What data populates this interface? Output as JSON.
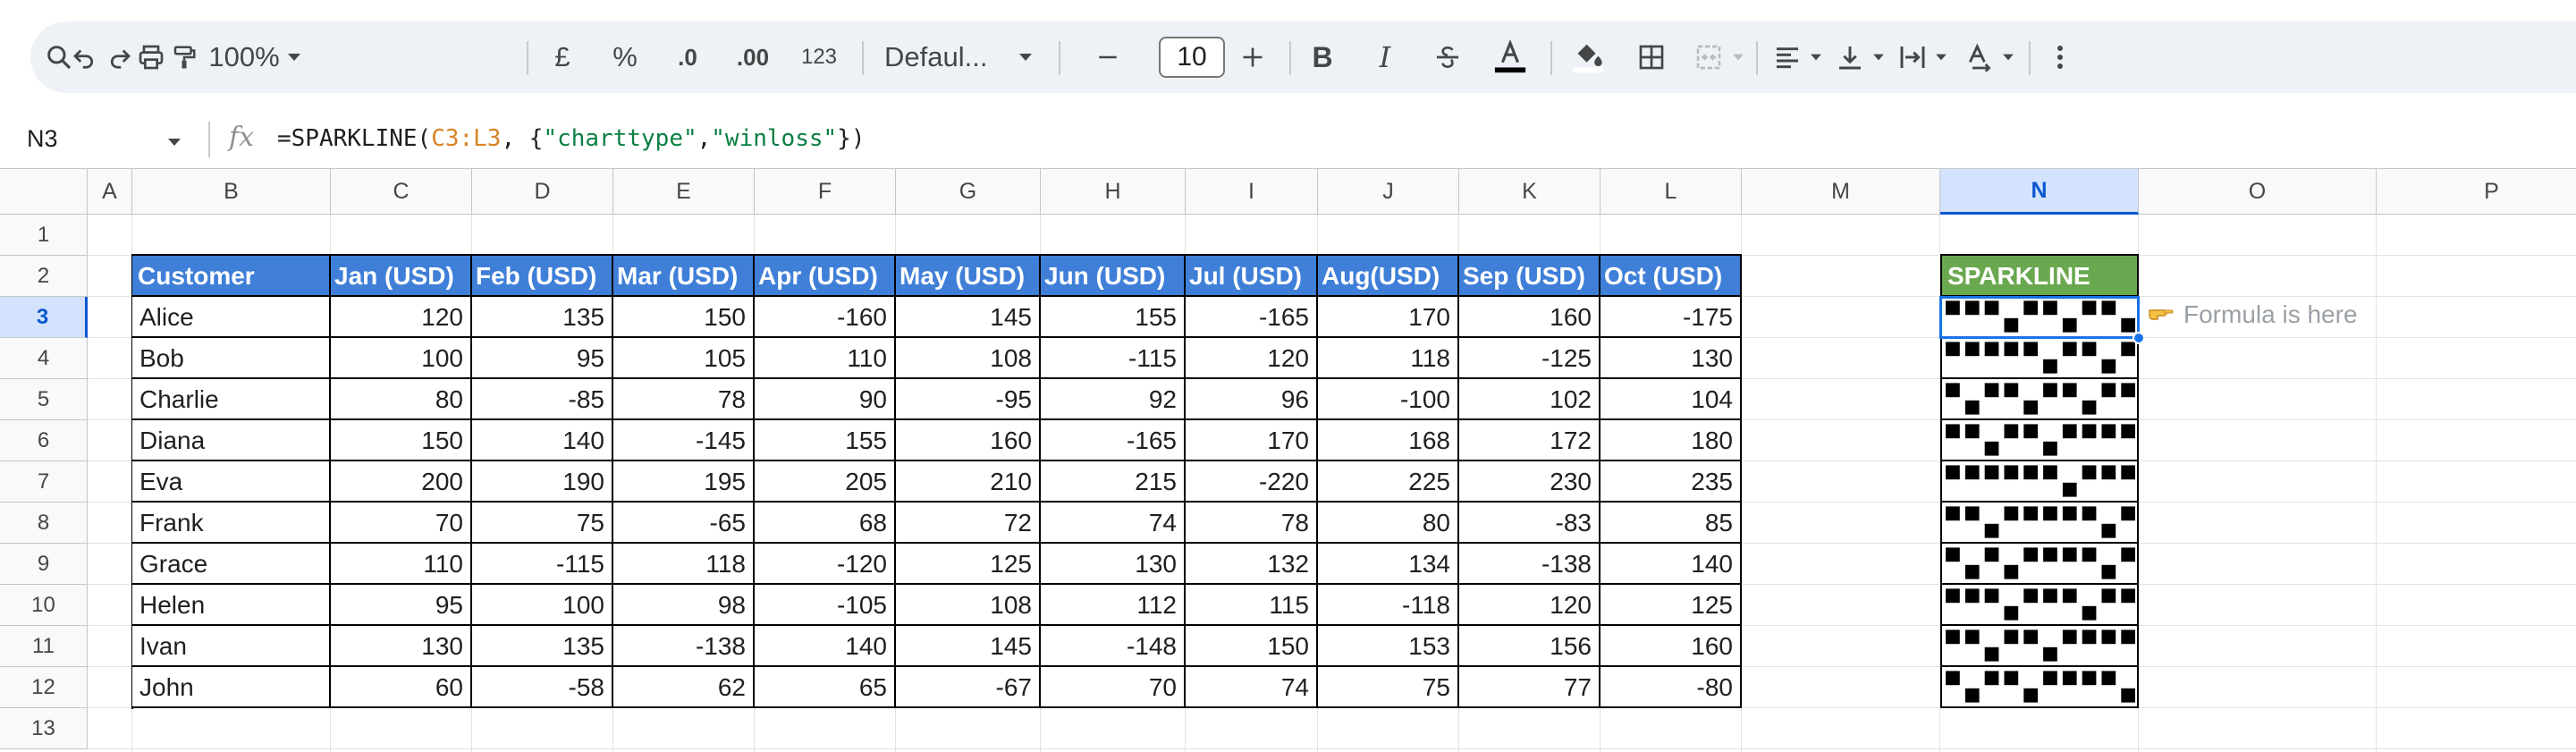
{
  "toolbar": {
    "zoom": "100%",
    "currency": "£",
    "percent": "%",
    "decrease_decimal": ".0",
    "increase_decimal": ".00",
    "number_format": "123",
    "font": "Defaul...",
    "font_size": "10",
    "icons": [
      "search-icon",
      "undo-icon",
      "redo-icon",
      "print-icon",
      "paint-format-icon",
      "bold-icon",
      "italic-icon",
      "strikethrough-icon",
      "text-color-icon",
      "fill-color-icon",
      "borders-icon",
      "merge-cells-icon",
      "align-left-icon",
      "vertical-align-icon",
      "text-wrap-icon",
      "text-rotation-icon",
      "more-vert-icon"
    ],
    "colors": {
      "text_color": "#000000",
      "fill_color": "#ffffff"
    }
  },
  "formula_bar": {
    "name_box": "N3",
    "fx": "fx",
    "formula_prefix": "=SPARKLINE(",
    "formula_range": "C3:L3",
    "formula_mid1": ", {",
    "formula_str1": "\"charttype\"",
    "formula_comma": ",",
    "formula_str2": "\"winloss\"",
    "formula_suffix": "})"
  },
  "columns": [
    "A",
    "B",
    "C",
    "D",
    "E",
    "F",
    "G",
    "H",
    "I",
    "J",
    "K",
    "L",
    "M",
    "N",
    "O",
    "P"
  ],
  "rows": [
    "1",
    "2",
    "3",
    "4",
    "5",
    "6",
    "7",
    "8",
    "9",
    "10",
    "11",
    "12",
    "13"
  ],
  "selected": {
    "column": "N",
    "row": "3"
  },
  "table": {
    "headers": [
      "Customer",
      "Jan (USD)",
      "Feb (USD)",
      "Mar (USD)",
      "Apr (USD)",
      "May (USD)",
      "Jun (USD)",
      "Jul (USD)",
      "Aug(USD)",
      "Sep (USD)",
      "Oct (USD)"
    ],
    "sparkline_header": "SPARKLINE",
    "rows": [
      {
        "name": "Alice",
        "values": [
          "120",
          "135",
          "150",
          "-160",
          "145",
          "155",
          "-165",
          "170",
          "160",
          "-175"
        ]
      },
      {
        "name": "Bob",
        "values": [
          "100",
          "95",
          "105",
          "110",
          "108",
          "-115",
          "120",
          "118",
          "-125",
          "130"
        ]
      },
      {
        "name": "Charlie",
        "values": [
          "80",
          "-85",
          "78",
          "90",
          "-95",
          "92",
          "96",
          "-100",
          "102",
          "104"
        ]
      },
      {
        "name": "Diana",
        "values": [
          "150",
          "140",
          "-145",
          "155",
          "160",
          "-165",
          "170",
          "168",
          "172",
          "180"
        ]
      },
      {
        "name": "Eva",
        "values": [
          "200",
          "190",
          "195",
          "205",
          "210",
          "215",
          "-220",
          "225",
          "230",
          "235"
        ]
      },
      {
        "name": "Frank",
        "values": [
          "70",
          "75",
          "-65",
          "68",
          "72",
          "74",
          "78",
          "80",
          "-83",
          "85"
        ]
      },
      {
        "name": "Grace",
        "values": [
          "110",
          "-115",
          "118",
          "-120",
          "125",
          "130",
          "132",
          "134",
          "-138",
          "140"
        ]
      },
      {
        "name": "Helen",
        "values": [
          "95",
          "100",
          "98",
          "-105",
          "108",
          "112",
          "115",
          "-118",
          "120",
          "125"
        ]
      },
      {
        "name": "Ivan",
        "values": [
          "130",
          "135",
          "-138",
          "140",
          "145",
          "-148",
          "150",
          "153",
          "156",
          "160"
        ]
      },
      {
        "name": "John",
        "values": [
          "60",
          "-58",
          "62",
          "65",
          "-67",
          "70",
          "74",
          "75",
          "77",
          "-80"
        ]
      }
    ]
  },
  "note": {
    "icon": "pointing-hand-icon",
    "text": "Formula is here"
  }
}
